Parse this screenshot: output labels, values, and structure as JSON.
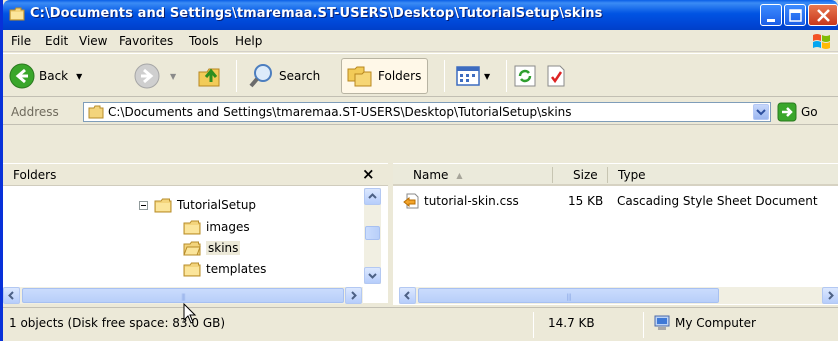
{
  "window": {
    "title": "C:\\Documents and Settings\\tmaremaa.ST-USERS\\Desktop\\TutorialSetup\\skins",
    "title_bar_color": "#0054e3",
    "close_button_color": "#c8381c"
  },
  "menu": {
    "items": [
      "File",
      "Edit",
      "View",
      "Favorites",
      "Tools",
      "Help"
    ]
  },
  "toolbar": {
    "back_label": "Back",
    "search_label": "Search",
    "folders_label": "Folders",
    "icons": [
      "back-arrow-icon",
      "forward-arrow-icon",
      "up-folder-icon",
      "search-icon",
      "folders-icon",
      "views-icon",
      "sync-icon",
      "properties-icon"
    ]
  },
  "address": {
    "label": "Address",
    "path": "C:\\Documents and Settings\\tmaremaa.ST-USERS\\Desktop\\TutorialSetup\\skins",
    "go_label": "Go"
  },
  "folders_pane": {
    "title": "Folders",
    "close_glyph": "×",
    "tree": [
      {
        "label": "TutorialSetup",
        "expanded": true
      },
      {
        "label": "images"
      },
      {
        "label": "skins",
        "selected": true
      },
      {
        "label": "templates"
      }
    ]
  },
  "file_list": {
    "columns": [
      "Name",
      "Size",
      "Type"
    ],
    "sort_column": "Name",
    "rows": [
      {
        "name": "tutorial-skin.css",
        "size": "15 KB",
        "type": "Cascading Style Sheet Document"
      }
    ]
  },
  "status": {
    "objects": "1 objects (Disk free space: 83.0 GB)",
    "size": "14.7 KB",
    "location": "My Computer"
  }
}
